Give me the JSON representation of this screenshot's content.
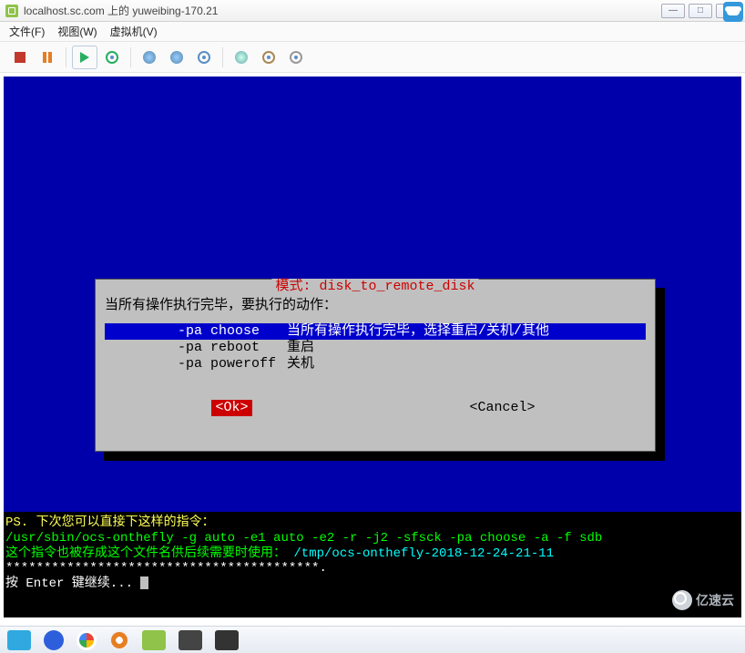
{
  "window": {
    "title": "localhost.sc.com 上的 yuweibing-170.21"
  },
  "menubar": {
    "file": "文件(F)",
    "view": "视图(W)",
    "vm": "虚拟机(V)"
  },
  "dialog": {
    "title": "模式: disk_to_remote_disk",
    "prompt": "当所有操作执行完毕，要执行的动作：",
    "options": [
      {
        "cmd": "-pa choose",
        "desc": "当所有操作执行完毕，选择重启/关机/其他",
        "selected": true
      },
      {
        "cmd": "-pa reboot",
        "desc": "重启",
        "selected": false
      },
      {
        "cmd": "-pa poweroff",
        "desc": "关机",
        "selected": false
      }
    ],
    "ok": "<Ok>",
    "cancel": "<Cancel>"
  },
  "terminal": {
    "ps_label": "PS.",
    "ps_text": " 下次您可以直接下这样的指令：",
    "cmd": "/usr/sbin/ocs-onthefly -g auto -e1 auto -e2 -r -j2 -sfsck -pa choose -a -f sdb",
    "save_text": "这个指令也被存成这个文件名供后续需要时使用：",
    "save_path": "/tmp/ocs-onthefly-2018-12-24-21-11",
    "stars": "*****************************************.",
    "prompt": "按 Enter 键继续... "
  },
  "watermark": "亿速云"
}
